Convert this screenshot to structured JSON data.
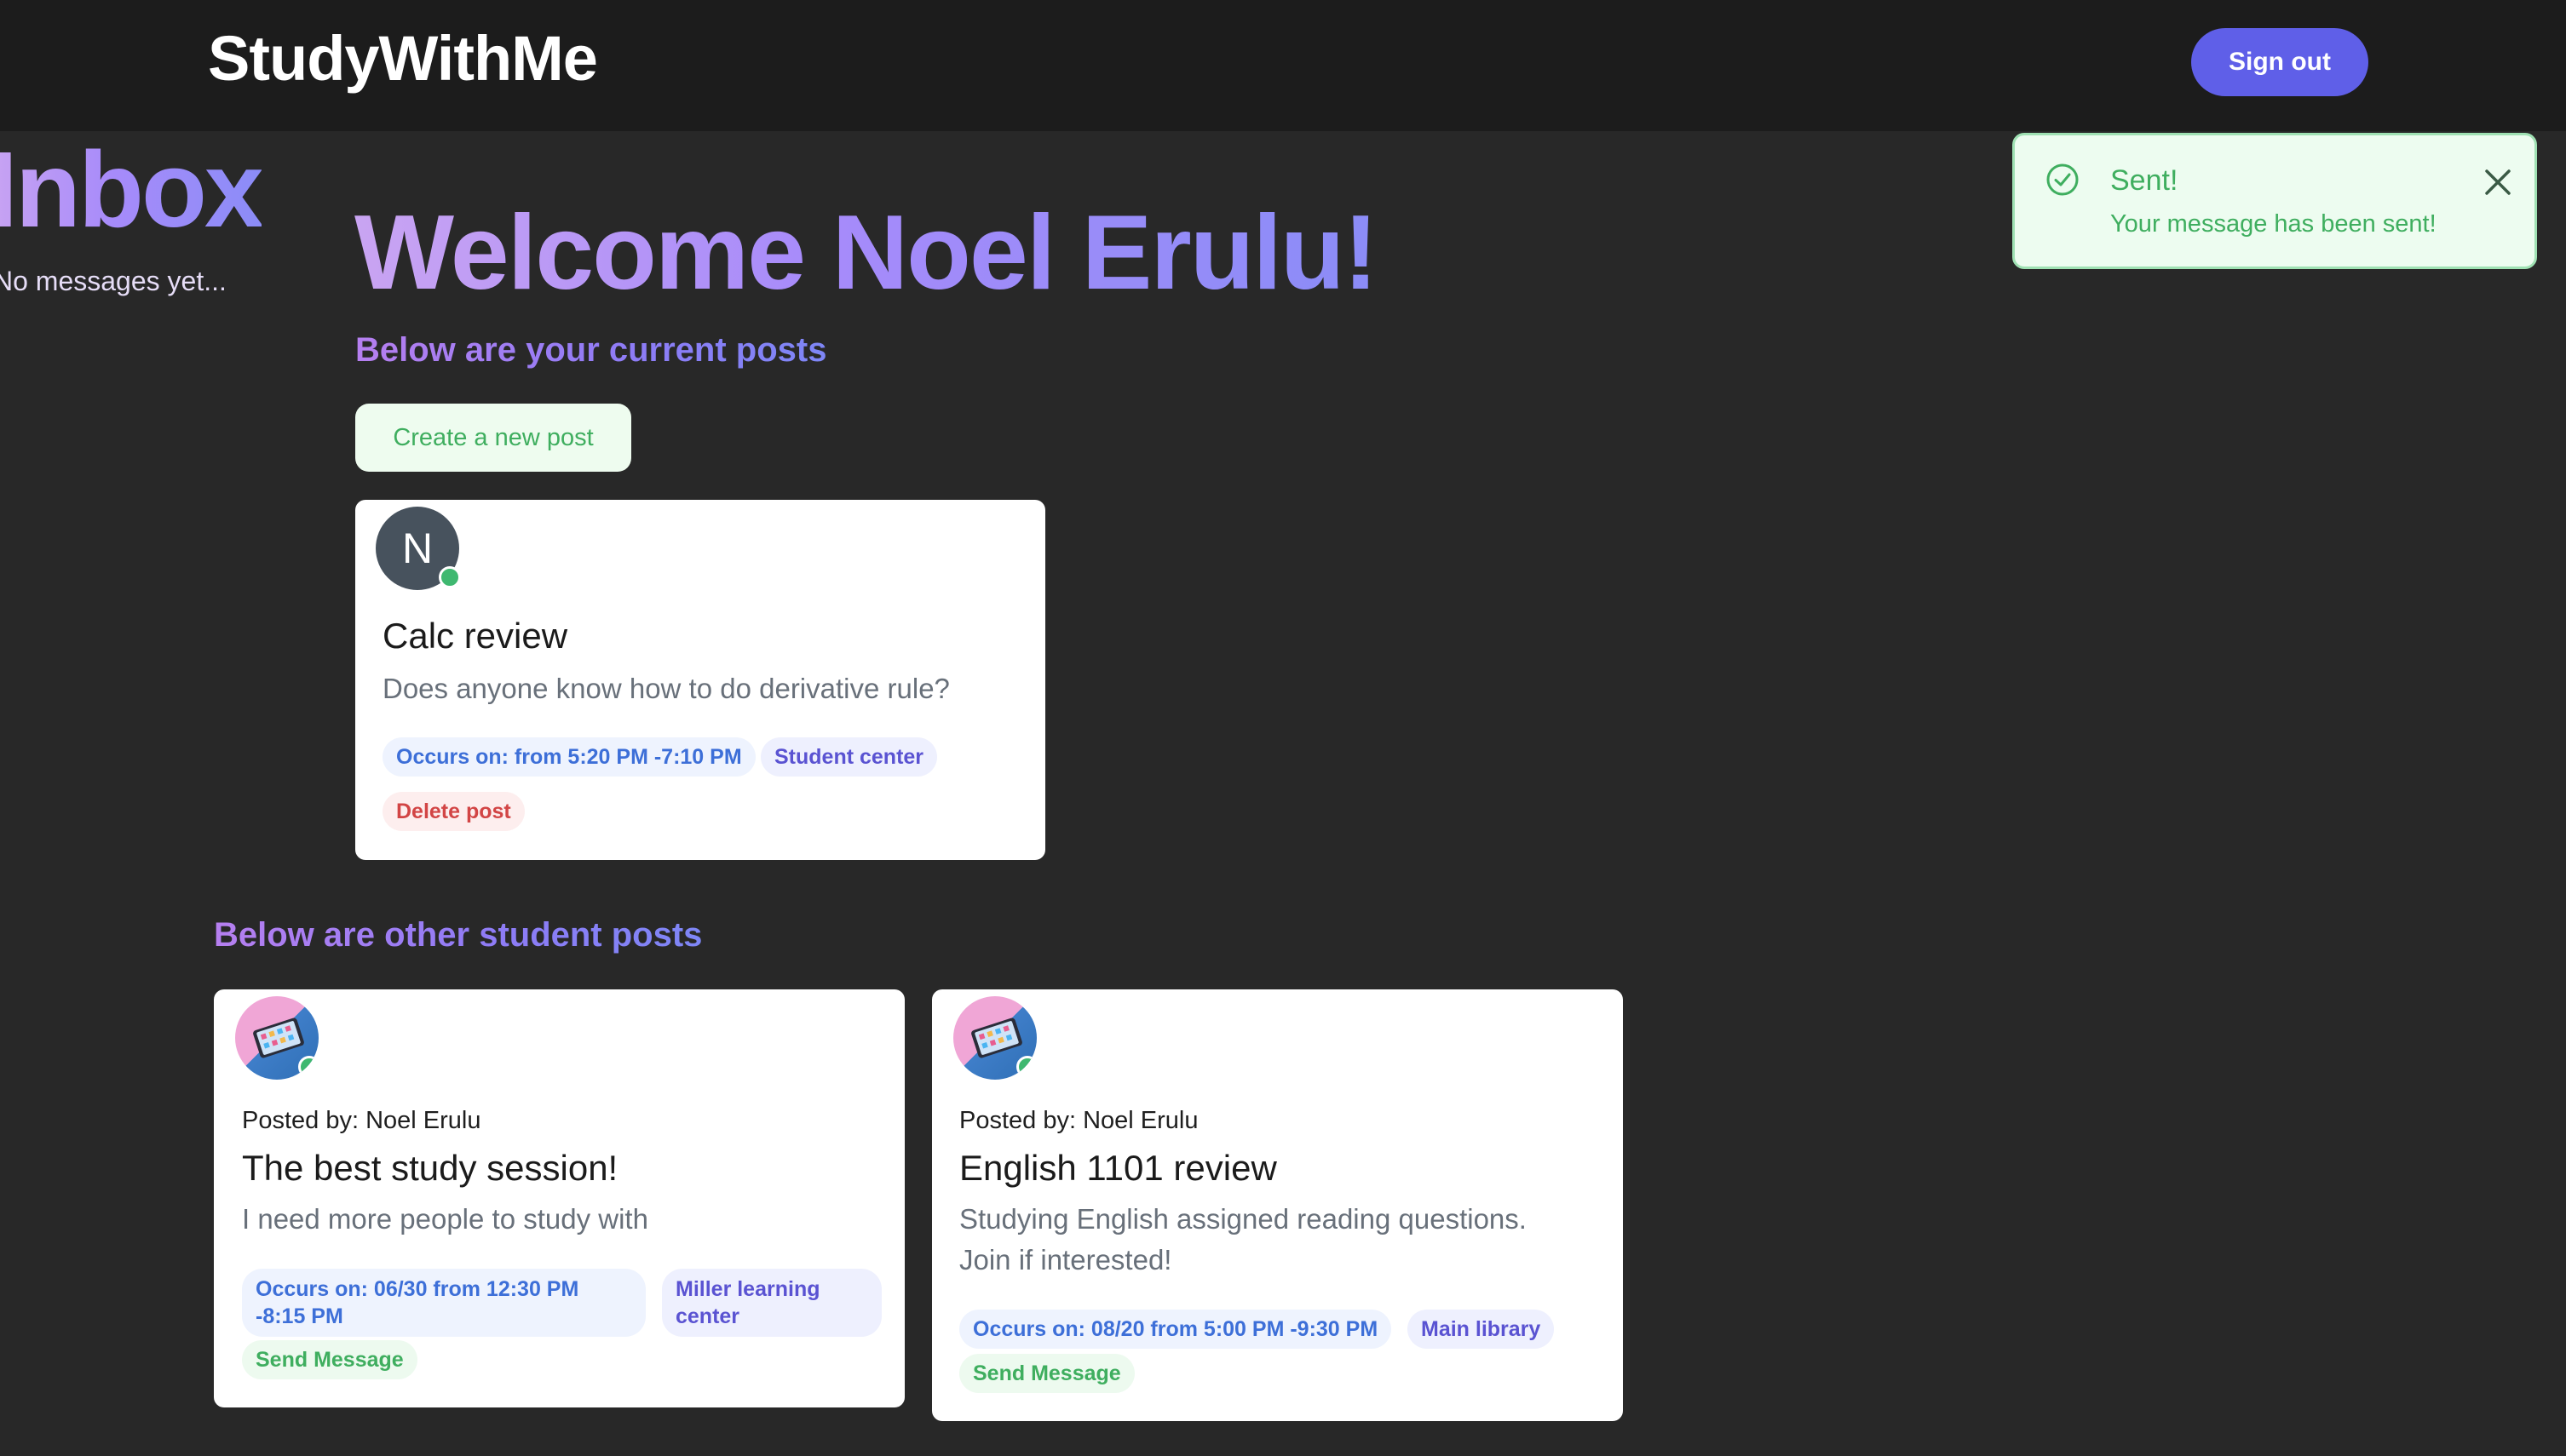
{
  "app": {
    "title": "StudyWithMe",
    "signout_label": "Sign out"
  },
  "inbox": {
    "title": "Inbox",
    "empty_text": "No messages yet..."
  },
  "main": {
    "welcome": "Welcome Noel Erulu!",
    "current_posts_heading": "Below are your current posts",
    "create_post_label": "Create a new post",
    "other_posts_heading": "Below are other student posts"
  },
  "my_posts": [
    {
      "avatar_letter": "N",
      "title": "Calc review",
      "description": "Does anyone know how to do derivative rule?",
      "time": "Occurs on: from 5:20 PM -7:10 PM",
      "location": "Student center",
      "action": "Delete post"
    }
  ],
  "other_posts": [
    {
      "posted_by": "Posted by: Noel Erulu",
      "title": "The best study session!",
      "description": "I need more people to study with",
      "time": "Occurs on: 06/30 from 12:30 PM -8:15 PM",
      "location": "Miller learning center",
      "action": "Send Message"
    },
    {
      "posted_by": "Posted by: Noel Erulu",
      "title": "English 1101 review",
      "description": "Studying English assigned reading questions. Join if interested!",
      "time": "Occurs on: 08/20 from 5:00 PM -9:30 PM",
      "location": "Main library",
      "action": "Send Message"
    }
  ],
  "toast": {
    "title": "Sent!",
    "message": "Your message has been sent!",
    "icon": "check-circle-icon",
    "close_icon": "close-icon"
  },
  "colors": {
    "background": "#282828",
    "header": "#1c1c1c",
    "accent": "#5f5fe8",
    "success": "#3fae5f",
    "danger": "#d24545"
  }
}
